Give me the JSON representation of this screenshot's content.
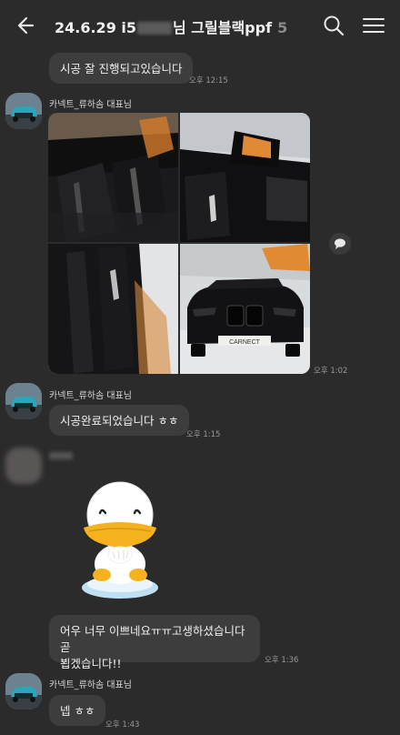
{
  "header": {
    "title_prefix": "24.6.29 i5",
    "title_suffix": "님 그릴블랙ppf",
    "member_count": "5"
  },
  "messages": [
    {
      "text": "시공 잘 진행되고있습니다",
      "time": "오후 12:15"
    },
    {
      "sender": "카넥트_류하솜 대표님",
      "time": "오후 1:02"
    },
    {
      "sender": "카넥트_류하솜 대표님",
      "text": "시공완료되었습니다 ㅎㅎ",
      "time": "오후 1:15"
    },
    {
      "text_line1": "어우 너무 이쁘네요ㅠㅠ고생하셨습니다 곧",
      "text_line2": "뵙겠습니다!!",
      "time": "오후 1:36"
    },
    {
      "sender": "카넥트_류하솜 대표님",
      "text": "넵 ㅎㅎ",
      "time": "오후 1:43"
    }
  ],
  "photo_caption": "CARNECT",
  "icons": {
    "back": "back-arrow-icon",
    "search": "search-icon",
    "menu": "hamburger-menu-icon",
    "share": "speech-bubble-icon"
  }
}
